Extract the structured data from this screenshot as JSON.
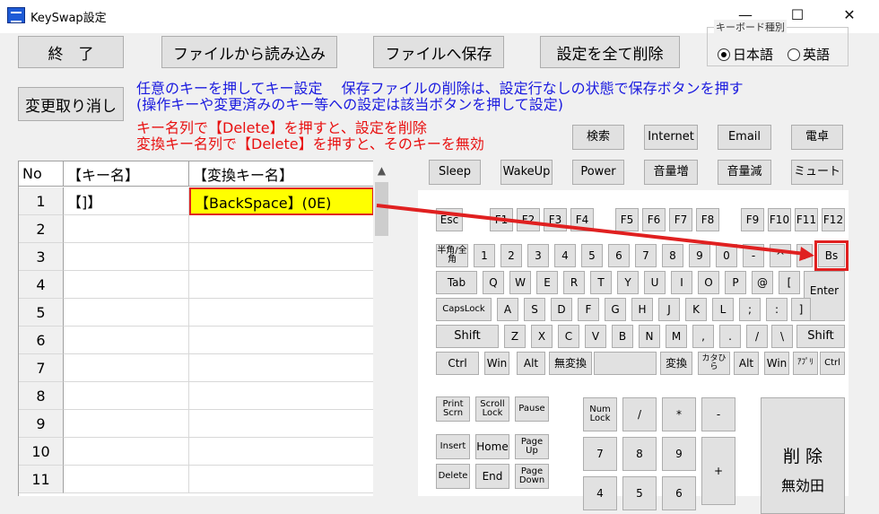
{
  "window": {
    "title": "KeySwap設定",
    "minimize": "—",
    "maximize": "☐",
    "close": "✕"
  },
  "toolbar": {
    "exit": "終　了",
    "load": "ファイルから読み込み",
    "save": "ファイルへ保存",
    "delete_all": "設定を全て削除",
    "undo": "変更取り消し"
  },
  "keyboard_type": {
    "title": "キーボード種別",
    "japanese": "日本語",
    "english": "英語",
    "selected": "japanese"
  },
  "info": {
    "line1": "任意のキーを押してキー設定　 保存ファイルの削除は、設定行なしの状態で保存ボタンを押す",
    "line2": "(操作キーや変更済みのキー等への設定は該当ボタンを押して設定)",
    "line3": "キー名列で【Delete】を押すと、設定を削除",
    "line4": "変換キー名列で【Delete】を押すと、そのキーを無効"
  },
  "table": {
    "headers": [
      "No",
      "【キー名】",
      "【変換キー名】"
    ],
    "rows": [
      {
        "no": "1",
        "key": "【]】",
        "swap": "【BackSpace】(0E)"
      },
      {
        "no": "2",
        "key": "",
        "swap": ""
      },
      {
        "no": "3",
        "key": "",
        "swap": ""
      },
      {
        "no": "4",
        "key": "",
        "swap": ""
      },
      {
        "no": "5",
        "key": "",
        "swap": ""
      },
      {
        "no": "6",
        "key": "",
        "swap": ""
      },
      {
        "no": "7",
        "key": "",
        "swap": ""
      },
      {
        "no": "8",
        "key": "",
        "swap": ""
      },
      {
        "no": "9",
        "key": "",
        "swap": ""
      },
      {
        "no": "10",
        "key": "",
        "swap": ""
      },
      {
        "no": "11",
        "key": "",
        "swap": ""
      }
    ]
  },
  "special_keys": {
    "search": "検索",
    "internet": "Internet",
    "email": "Email",
    "calc": "電卓",
    "sleep": "Sleep",
    "wakeup": "WakeUp",
    "power": "Power",
    "volup": "音量増",
    "voldown": "音量減",
    "mute": "ミュート"
  },
  "keyboard": {
    "esc": "Esc",
    "f": [
      "F1",
      "F2",
      "F3",
      "F4",
      "F5",
      "F6",
      "F7",
      "F8",
      "F9",
      "F10",
      "F11",
      "F12"
    ],
    "row1": [
      "半角/全角",
      "1",
      "2",
      "3",
      "4",
      "5",
      "6",
      "7",
      "8",
      "9",
      "0",
      "-",
      "^",
      "¥",
      "Bs"
    ],
    "row2": [
      "Tab",
      "Q",
      "W",
      "E",
      "R",
      "T",
      "Y",
      "U",
      "I",
      "O",
      "P",
      "@",
      "[",
      "Enter"
    ],
    "row3": [
      "CapsLock",
      "A",
      "S",
      "D",
      "F",
      "G",
      "H",
      "J",
      "K",
      "L",
      ";",
      ":",
      "]"
    ],
    "row4": [
      "Shift",
      "Z",
      "X",
      "C",
      "V",
      "B",
      "N",
      "M",
      ",",
      ".",
      "/",
      "\\",
      "Shift"
    ],
    "row5": [
      "Ctrl",
      "Win",
      "Alt",
      "無変換",
      "",
      "変換",
      "カタひら",
      "Alt",
      "Win",
      "ｱﾌﾟﾘ",
      "Ctrl"
    ],
    "nav": [
      "Print Scrn",
      "Scroll Lock",
      "Pause",
      "Insert",
      "Home",
      "Page Up",
      "Delete",
      "End",
      "Page Down"
    ],
    "numpad": [
      "Num Lock",
      "/",
      "*",
      "-",
      "7",
      "8",
      "9",
      "+",
      "4",
      "5",
      "6"
    ],
    "delete_btn": "削 除",
    "disable_btn": "無効田"
  }
}
